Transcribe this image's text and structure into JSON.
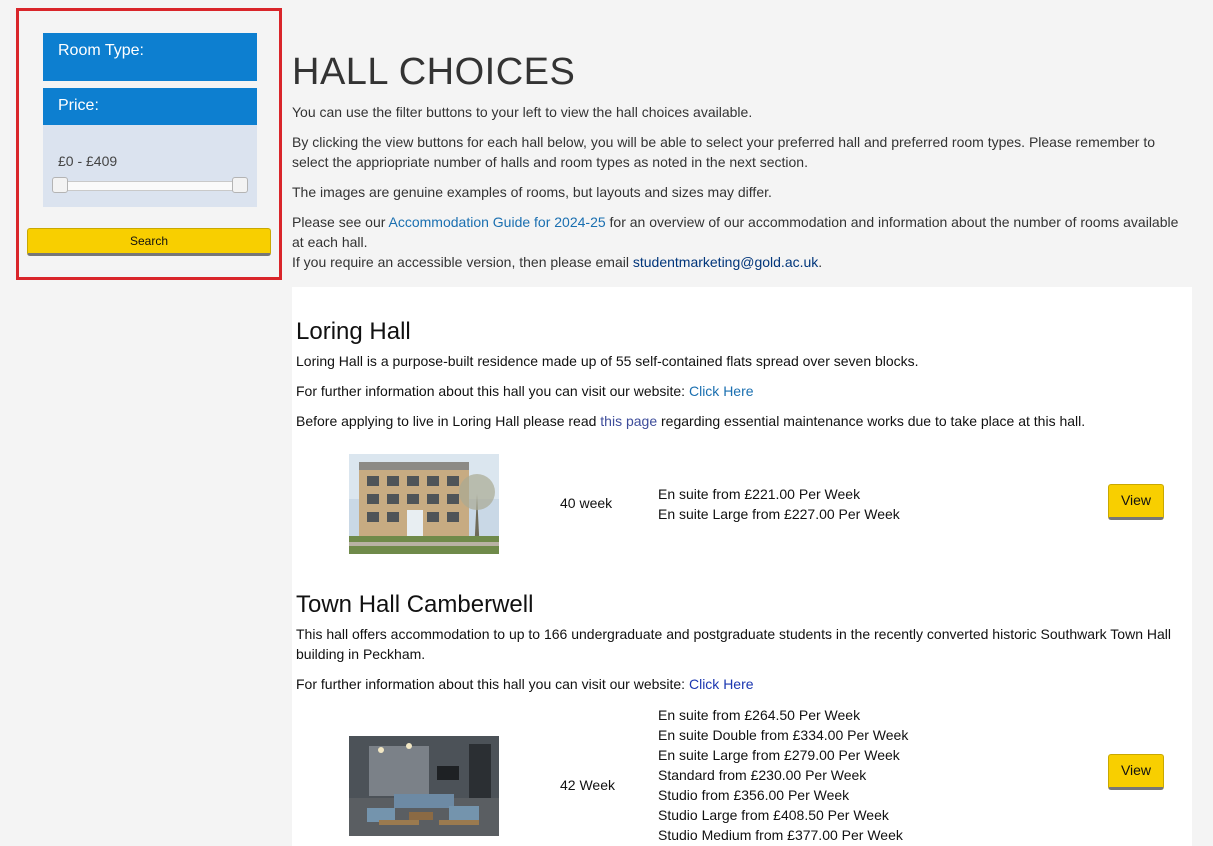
{
  "filters": {
    "room_type_label": "Room Type:",
    "price_label": "Price:",
    "price_range": "£0 - £409",
    "price_min": 0,
    "price_max": 409,
    "search_label": "Search",
    "accent": "#0d7fd0",
    "highlight_border": "#d9252a"
  },
  "main": {
    "title": "HALL CHOICES",
    "intro1": "You can use the filter buttons to your left to view the hall choices available.",
    "intro2": "By clicking the view buttons for each hall below, you will be able to select your preferred hall and preferred room types. Please remember to select the appriopriate number of halls and room types as noted in the next section.",
    "intro3": "The images are genuine examples of rooms, but layouts and sizes may differ.",
    "guide_prefix": "Please see our ",
    "guide_link": "Accommodation Guide for 2024-25",
    "guide_suffix": " for an overview of our accommodation and information about the number of rooms available at each hall.",
    "access_prefix": "If you require an accessible version, then please email ",
    "access_email": "studentmarketing@gold.ac.uk",
    "access_suffix": "."
  },
  "halls": [
    {
      "name": "Loring Hall",
      "description": "Loring Hall is a purpose-built residence made up of 55 self-contained flats spread over seven blocks.",
      "info_prefix": "For further information about this hall you can visit our website: ",
      "info_link": "Click Here",
      "notice_prefix": "Before applying to live in Loring Hall please read ",
      "notice_link": "this page",
      "notice_suffix": " regarding essential maintenance works due to take place at this hall.",
      "contract": "40 week",
      "prices": [
        "En suite from £221.00 Per Week",
        "En suite Large from £227.00 Per Week"
      ],
      "view_label": "View"
    },
    {
      "name": "Town Hall Camberwell",
      "description": "This hall offers accommodation to up to 166 undergraduate and postgraduate students in the recently converted historic Southwark Town Hall building in Peckham.",
      "info_prefix": "For further information about this hall you can visit our website: ",
      "info_link": "Click Here",
      "contract": "42 Week",
      "prices": [
        "En suite from £264.50 Per Week",
        "En suite Double from £334.00 Per Week",
        "En suite Large from £279.00 Per Week",
        "Standard from £230.00 Per Week",
        "Studio from £356.00 Per Week",
        "Studio Large from £408.50 Per Week",
        "Studio Medium from £377.00 Per Week"
      ],
      "view_label": "View"
    }
  ]
}
